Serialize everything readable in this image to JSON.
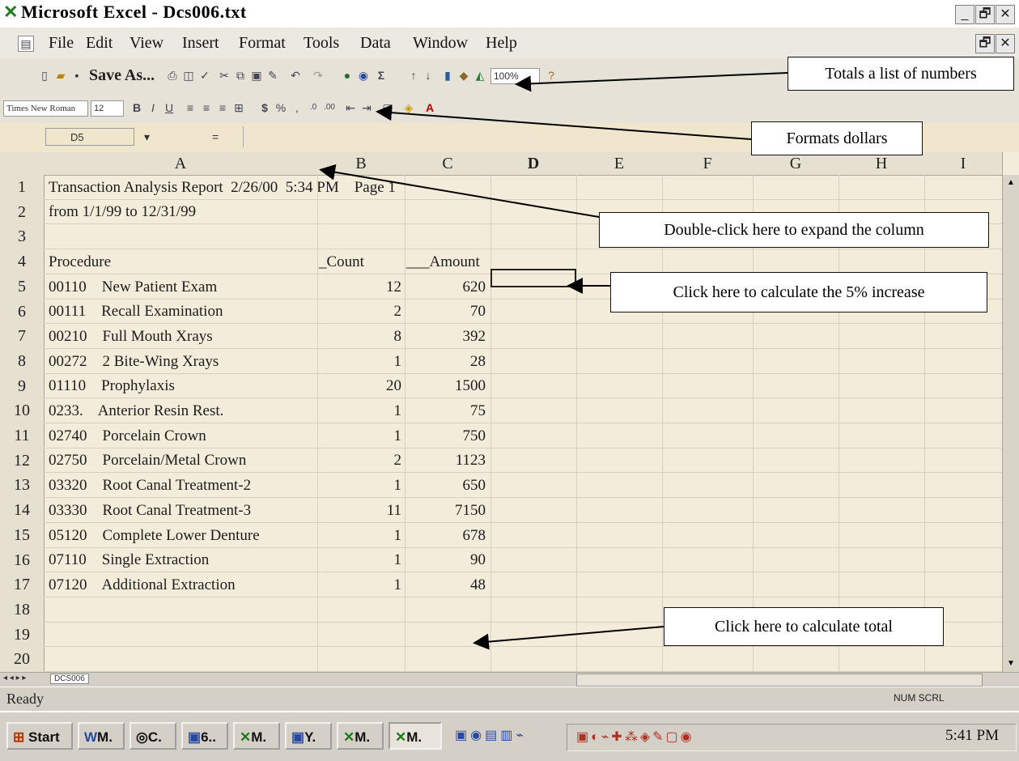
{
  "window": {
    "title": "Microsoft Excel - Dcs006.txt",
    "min_label": "_",
    "max_label": "🗗",
    "close_label": "✕"
  },
  "menu": [
    "File",
    "Edit",
    "View",
    "Insert",
    "Format",
    "Tools",
    "Data",
    "Window",
    "Help"
  ],
  "toolbar1": {
    "save_as_label": "Save As...",
    "zoom": "100%"
  },
  "toolbar2": {
    "font_name": "Times New Roman",
    "font_size": "12"
  },
  "formula_bar": {
    "name_box": "D5",
    "fx": "="
  },
  "columns": [
    "A",
    "B",
    "C",
    "D",
    "E",
    "F",
    "G",
    "H",
    "I"
  ],
  "rows": [
    {
      "n": "1",
      "a": "Transaction Analysis Report  2/26/00  5:34 PM    Page 1",
      "b": "",
      "c": ""
    },
    {
      "n": "2",
      "a": "from 1/1/99 to 12/31/99",
      "b": "",
      "c": ""
    },
    {
      "n": "3",
      "a": "",
      "b": "",
      "c": ""
    },
    {
      "n": "4",
      "a": "Procedure",
      "b": "_Count",
      "c": "___Amount"
    },
    {
      "n": "5",
      "a": "00110    New Patient Exam",
      "b": "12",
      "c": "620"
    },
    {
      "n": "6",
      "a": "00111    Recall Examination",
      "b": "2",
      "c": "70"
    },
    {
      "n": "7",
      "a": "00210    Full Mouth Xrays",
      "b": "8",
      "c": "392"
    },
    {
      "n": "8",
      "a": "00272    2 Bite-Wing Xrays",
      "b": "1",
      "c": "28"
    },
    {
      "n": "9",
      "a": "01110    Prophylaxis",
      "b": "20",
      "c": "1500"
    },
    {
      "n": "10",
      "a": "0233.    Anterior Resin Rest.",
      "b": "1",
      "c": "75"
    },
    {
      "n": "11",
      "a": "02740    Porcelain Crown",
      "b": "1",
      "c": "750"
    },
    {
      "n": "12",
      "a": "02750    Porcelain/Metal Crown",
      "b": "2",
      "c": "1123"
    },
    {
      "n": "13",
      "a": "03320    Root Canal Treatment-2",
      "b": "1",
      "c": "650"
    },
    {
      "n": "14",
      "a": "03330    Root Canal Treatment-3",
      "b": "11",
      "c": "7150"
    },
    {
      "n": "15",
      "a": "05120    Complete Lower Denture",
      "b": "1",
      "c": "678"
    },
    {
      "n": "16",
      "a": "07110    Single Extraction",
      "b": "1",
      "c": "90"
    },
    {
      "n": "17",
      "a": "07120    Additional Extraction",
      "b": "1",
      "c": "48"
    },
    {
      "n": "18",
      "a": "",
      "b": "",
      "c": ""
    },
    {
      "n": "19",
      "a": "",
      "b": "",
      "c": ""
    },
    {
      "n": "20",
      "a": "",
      "b": "",
      "c": ""
    }
  ],
  "sheet_tab": "DCS006",
  "status": {
    "ready": "Ready",
    "indicators": "NUM SCRL"
  },
  "taskbar": {
    "start": "Start",
    "buttons": [
      "M.",
      "C.",
      "6..",
      "M.",
      "Y.",
      "M.",
      "M."
    ],
    "clock": "5:41 PM"
  },
  "callouts": {
    "totals": "Totals a list of numbers",
    "formats": "Formats dollars",
    "expand": "Double-click here to expand the column",
    "increase": "Click here to calculate the 5% increase",
    "total": "Click here to calculate total"
  }
}
